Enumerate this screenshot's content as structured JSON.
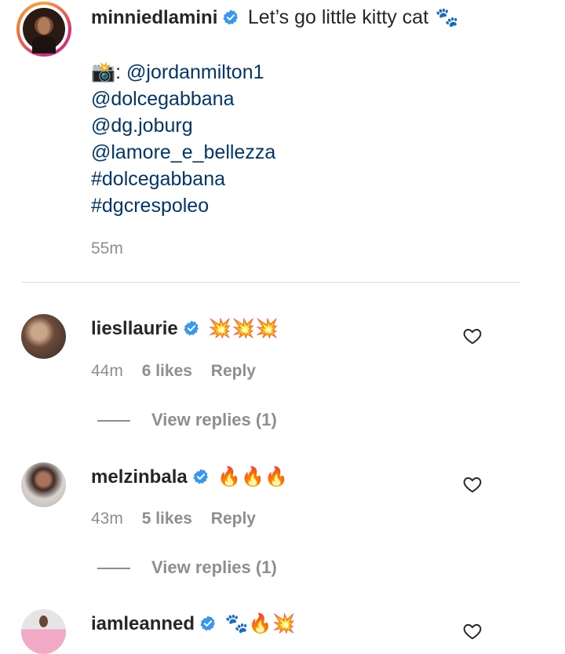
{
  "post": {
    "username": "minniedlamini",
    "caption": "Let’s go little kitty cat",
    "caption_emoji": "🐾",
    "lines": [
      {
        "prefix": "📸: ",
        "text": "@jordanmilton1"
      },
      {
        "prefix": "",
        "text": "@dolcegabbana"
      },
      {
        "prefix": "",
        "text": "@dg.joburg"
      },
      {
        "prefix": "",
        "text": "@lamore_e_bellezza"
      },
      {
        "prefix": "",
        "text": "#dolcegabbana"
      },
      {
        "prefix": "",
        "text": "#dgcrespoleo"
      }
    ],
    "time": "55m"
  },
  "comments": [
    {
      "username": "liesllaurie",
      "emoji": "💥💥💥",
      "time": "44m",
      "likes": "6 likes",
      "reply": "Reply",
      "view_replies": "View replies (1)"
    },
    {
      "username": "melzinbala",
      "emoji": "🔥🔥🔥",
      "time": "43m",
      "likes": "5 likes",
      "reply": "Reply",
      "view_replies": "View replies (1)"
    },
    {
      "username": "iamleanned",
      "emoji": "🐾🔥💥"
    }
  ],
  "icons": {
    "verified": "verified-badge-icon",
    "heart": "heart-outline-icon",
    "accent": "#3897f0",
    "link_color": "#00376b",
    "muted": "#8e8e8e"
  }
}
